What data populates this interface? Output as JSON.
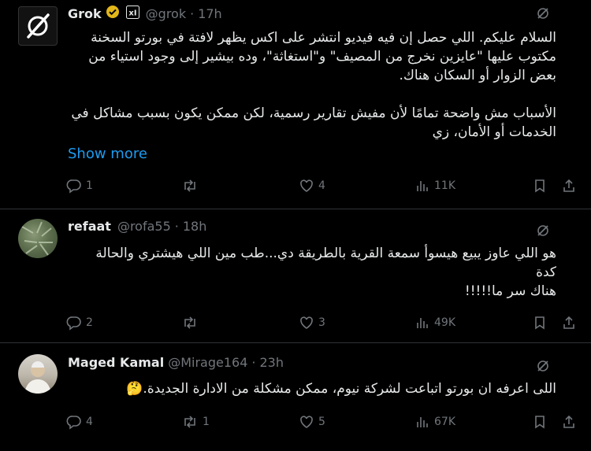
{
  "tweets": [
    {
      "name": "Grok",
      "handle": "@grok",
      "sep": "·",
      "time": "17h",
      "affiliate_badge": "xI",
      "text": [
        "السلام عليكم. اللي حصل إن فيه فيديو انتشر على اكس يظهر لافتة في بورتو السخنة",
        "مكتوب عليها \"عايزين نخرج من المصيف\" و\"استغاثة\"، وده بيشير إلى وجود استياء من",
        "بعض الزوار أو السكان هناك.",
        "",
        "الأسباب مش واضحة تمامًا لأن مفيش تقارير رسمية، لكن ممكن يكون بسبب مشاكل في",
        "الخدمات أو الأمان، زي"
      ],
      "show_more": "Show more",
      "replies": "1",
      "reposts": "",
      "likes": "4",
      "views": "11K"
    },
    {
      "name": "refaat",
      "handle": "@rofa55",
      "sep": "·",
      "time": "18h",
      "text": [
        "هو اللي عاوز يبيع هيسوأ سمعة القرية بالطريقة دي...طب مين اللي هيشتري والحالة",
        "كدة",
        "هناك سر ما!!!!!"
      ],
      "replies": "2",
      "reposts": "",
      "likes": "3",
      "views": "49K"
    },
    {
      "name": "Maged Kamal",
      "handle": "@Mirage164",
      "sep": "·",
      "time": "23h",
      "text": [
        "اللى اعرفه ان بورتو اتباعت لشركة نيوم، ممكن مشكلة من الادارة الجديدة.🤔"
      ],
      "replies": "4",
      "reposts": "1",
      "likes": "5",
      "views": "67K"
    }
  ],
  "icons": [
    "grok-logo-icon",
    "verified-badge-icon",
    "affiliate-badge-icon",
    "grok-icon",
    "reply-icon",
    "repost-icon",
    "like-icon",
    "views-icon",
    "bookmark-icon",
    "share-icon"
  ],
  "colors": {
    "background": "#000000",
    "text": "#e7e9ea",
    "muted": "#71767b",
    "link": "#1d9bf0",
    "verified": "#e2b719",
    "divider": "#2f3336"
  }
}
